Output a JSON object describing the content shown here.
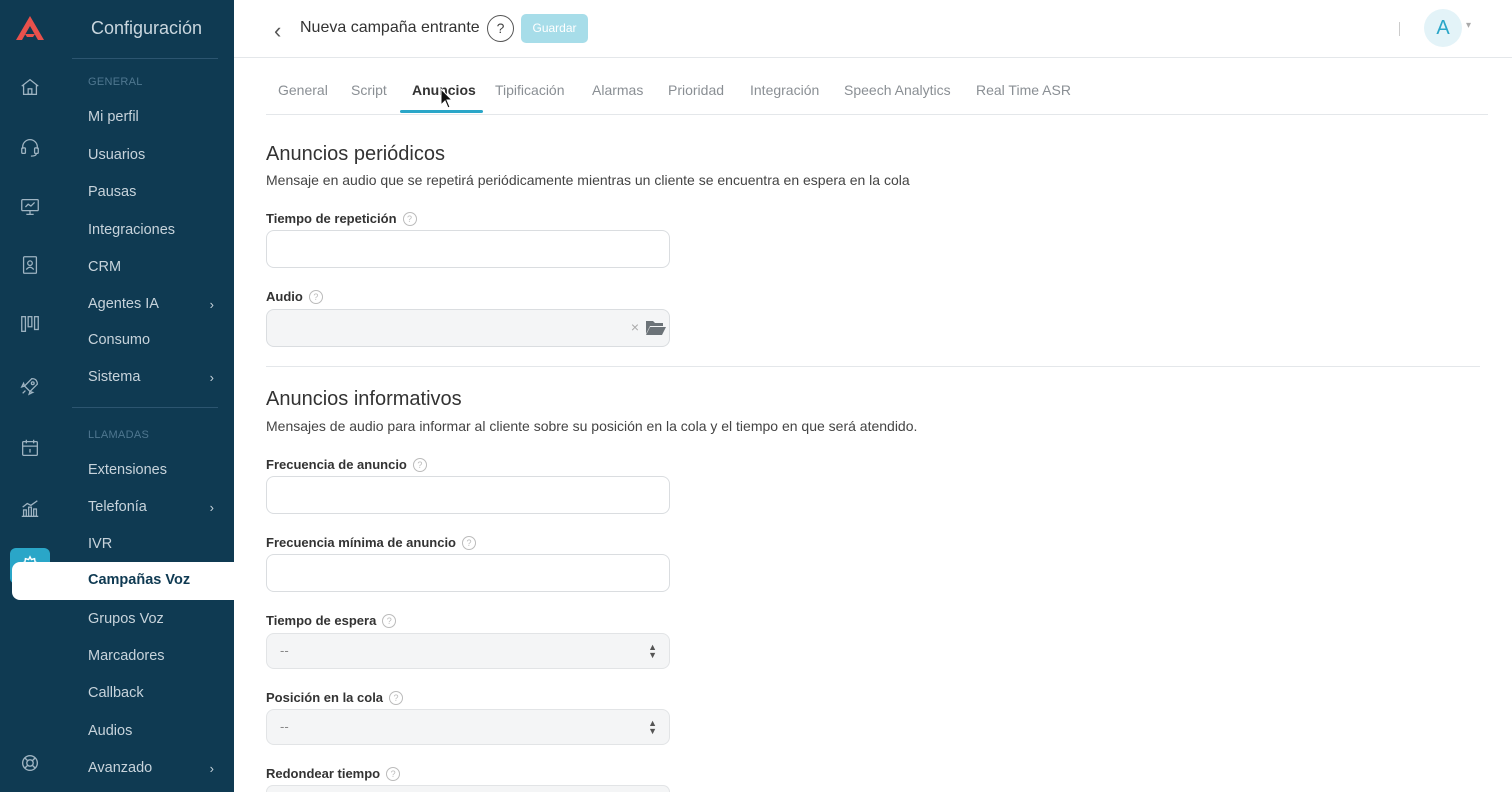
{
  "sidebar": {
    "title": "Configuración",
    "section_general": "GENERAL",
    "section_calls": "LLAMADAS",
    "items": [
      {
        "label": "Mi perfil",
        "chevron": false
      },
      {
        "label": "Usuarios",
        "chevron": false
      },
      {
        "label": "Pausas",
        "chevron": false
      },
      {
        "label": "Integraciones",
        "chevron": false
      },
      {
        "label": "CRM",
        "chevron": false
      },
      {
        "label": "Agentes IA",
        "chevron": true
      },
      {
        "label": "Consumo",
        "chevron": false
      },
      {
        "label": "Sistema",
        "chevron": true
      },
      {
        "label": "Extensiones",
        "chevron": false
      },
      {
        "label": "Telefonía",
        "chevron": true
      },
      {
        "label": "IVR",
        "chevron": false
      },
      {
        "label": "Campañas Voz",
        "chevron": false,
        "active": true
      },
      {
        "label": "Grupos Voz",
        "chevron": false
      },
      {
        "label": "Marcadores",
        "chevron": false
      },
      {
        "label": "Callback",
        "chevron": false
      },
      {
        "label": "Audios",
        "chevron": false
      },
      {
        "label": "Avanzado",
        "chevron": true
      }
    ],
    "chevron_glyph": "›"
  },
  "rail_icons": [
    "home-icon",
    "headset-icon",
    "monitor-icon",
    "contacts-icon",
    "kanban-icon",
    "rocket-icon",
    "calendar-icon",
    "chart-icon",
    "settings-icon",
    "support-icon"
  ],
  "header": {
    "back_glyph": "‹",
    "title": "Nueva campaña entrante",
    "help_glyph": "?",
    "save_label": "Guardar",
    "avatar_letter": "A",
    "caret_glyph": "▾"
  },
  "tabs": [
    {
      "label": "General"
    },
    {
      "label": "Script"
    },
    {
      "label": "Anuncios",
      "active": true
    },
    {
      "label": "Tipificación"
    },
    {
      "label": "Alarmas"
    },
    {
      "label": "Prioridad"
    },
    {
      "label": "Integración"
    },
    {
      "label": "Speech Analytics"
    },
    {
      "label": "Real Time ASR"
    }
  ],
  "periodic": {
    "title": "Anuncios periódicos",
    "description": "Mensaje en audio que se repetirá periódicamente mientras un cliente se encuentra en espera en la cola",
    "repeat_time_label": "Tiempo de repetición",
    "repeat_time_value": "",
    "audio_label": "Audio",
    "audio_value": "",
    "clear_glyph": "×"
  },
  "informative": {
    "title": "Anuncios informativos",
    "description": "Mensajes de audio para informar al cliente sobre su posición en la cola y el tiempo en que será atendido.",
    "frequency_label": "Frecuencia de anuncio",
    "frequency_value": "",
    "min_frequency_label": "Frecuencia mínima de anuncio",
    "min_frequency_value": "",
    "wait_time_label": "Tiempo de espera",
    "wait_time_value": "--",
    "queue_position_label": "Posición en la cola",
    "queue_position_value": "--",
    "round_time_label": "Redondear tiempo"
  },
  "help_glyph": "?"
}
